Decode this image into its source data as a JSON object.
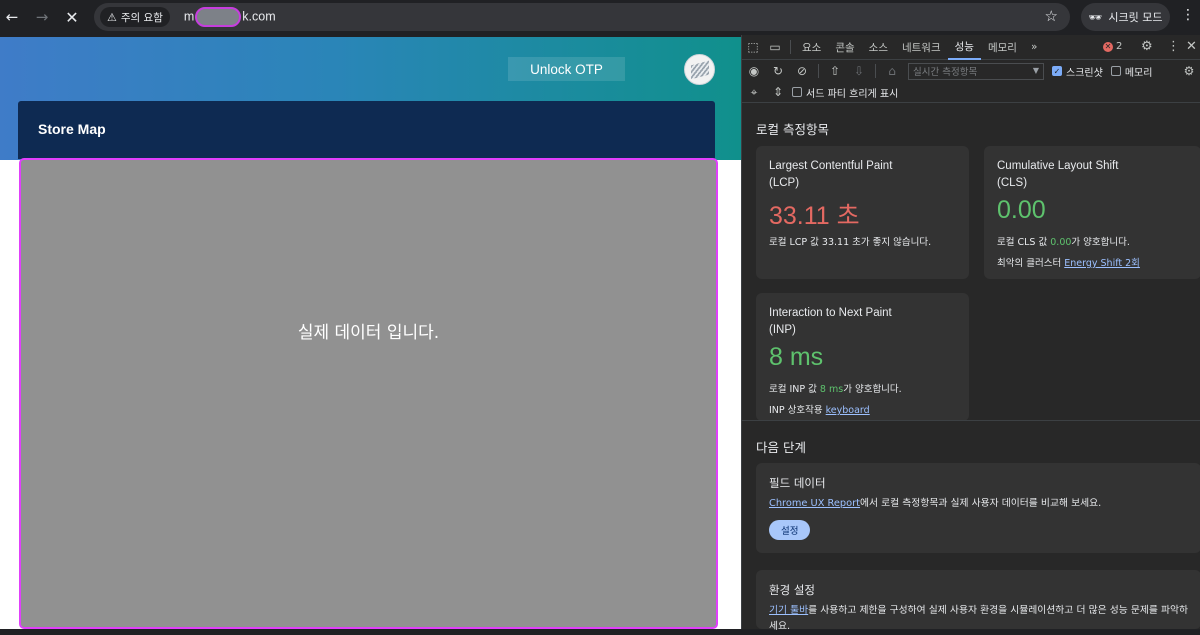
{
  "browser": {
    "warning_chip": "주의 요함",
    "url_prefix": "m",
    "url_suffix": "k.com",
    "incognito_label": "시크릿 모드"
  },
  "page": {
    "otp_button": "Unlock OTP",
    "store_title": "Store Map",
    "map_placeholder": "실제 데이터 입니다."
  },
  "devtools": {
    "tabs": [
      "요소",
      "콘솔",
      "소스",
      "네트워크",
      "성능",
      "메모리"
    ],
    "active_tab": "성능",
    "error_count": "2",
    "metric_select_placeholder": "실시간 측정항목",
    "screenshot_label": "스크린샷",
    "memory_label": "메모리",
    "third_party_label": "서드 파티 흐리게 표시",
    "local_metrics_heading": "로컬 측정항목",
    "lcp": {
      "name_line1": "Largest Contentful Paint",
      "name_line2": "(LCP)",
      "value": "33.11 초",
      "desc": "로컬 LCP 값 33.11 초가 좋지 않습니다."
    },
    "cls": {
      "name_line1": "Cumulative Layout Shift",
      "name_line2": "(CLS)",
      "value": "0.00",
      "desc_prefix": "로컬 CLS 값 ",
      "desc_value": "0.00",
      "desc_suffix": "가 양호합니다.",
      "cluster_label": "최악의 클러스터 ",
      "cluster_link": "Energy Shift 2회"
    },
    "inp": {
      "name_line1": "Interaction to Next Paint",
      "name_line2": "(INP)",
      "value": "8 ms",
      "desc_prefix": "로컬 INP 값 ",
      "desc_value": "8 ms",
      "desc_suffix": "가 양호합니다.",
      "interaction_label": "INP 상호작용 ",
      "interaction_link": "keyboard"
    },
    "next_steps_heading": "다음 단계",
    "field_data": {
      "title": "필드 데이터",
      "link": "Chrome UX Report",
      "text": "에서 로컬 측정항목과 실제 사용자 데이터를 비교해 보세요.",
      "button": "설정"
    },
    "env_settings": {
      "title": "환경 설정",
      "link": "기기 툴바",
      "text": "를 사용하고 제한을 구성하여 실제 사용자 환경을 시뮬레이션하고 더 많은 성능 문제를 파악하",
      "text2": "세요."
    }
  },
  "colors": {
    "bad": "#e46962",
    "good": "#5ec26d",
    "highlight": "#e040fb"
  }
}
